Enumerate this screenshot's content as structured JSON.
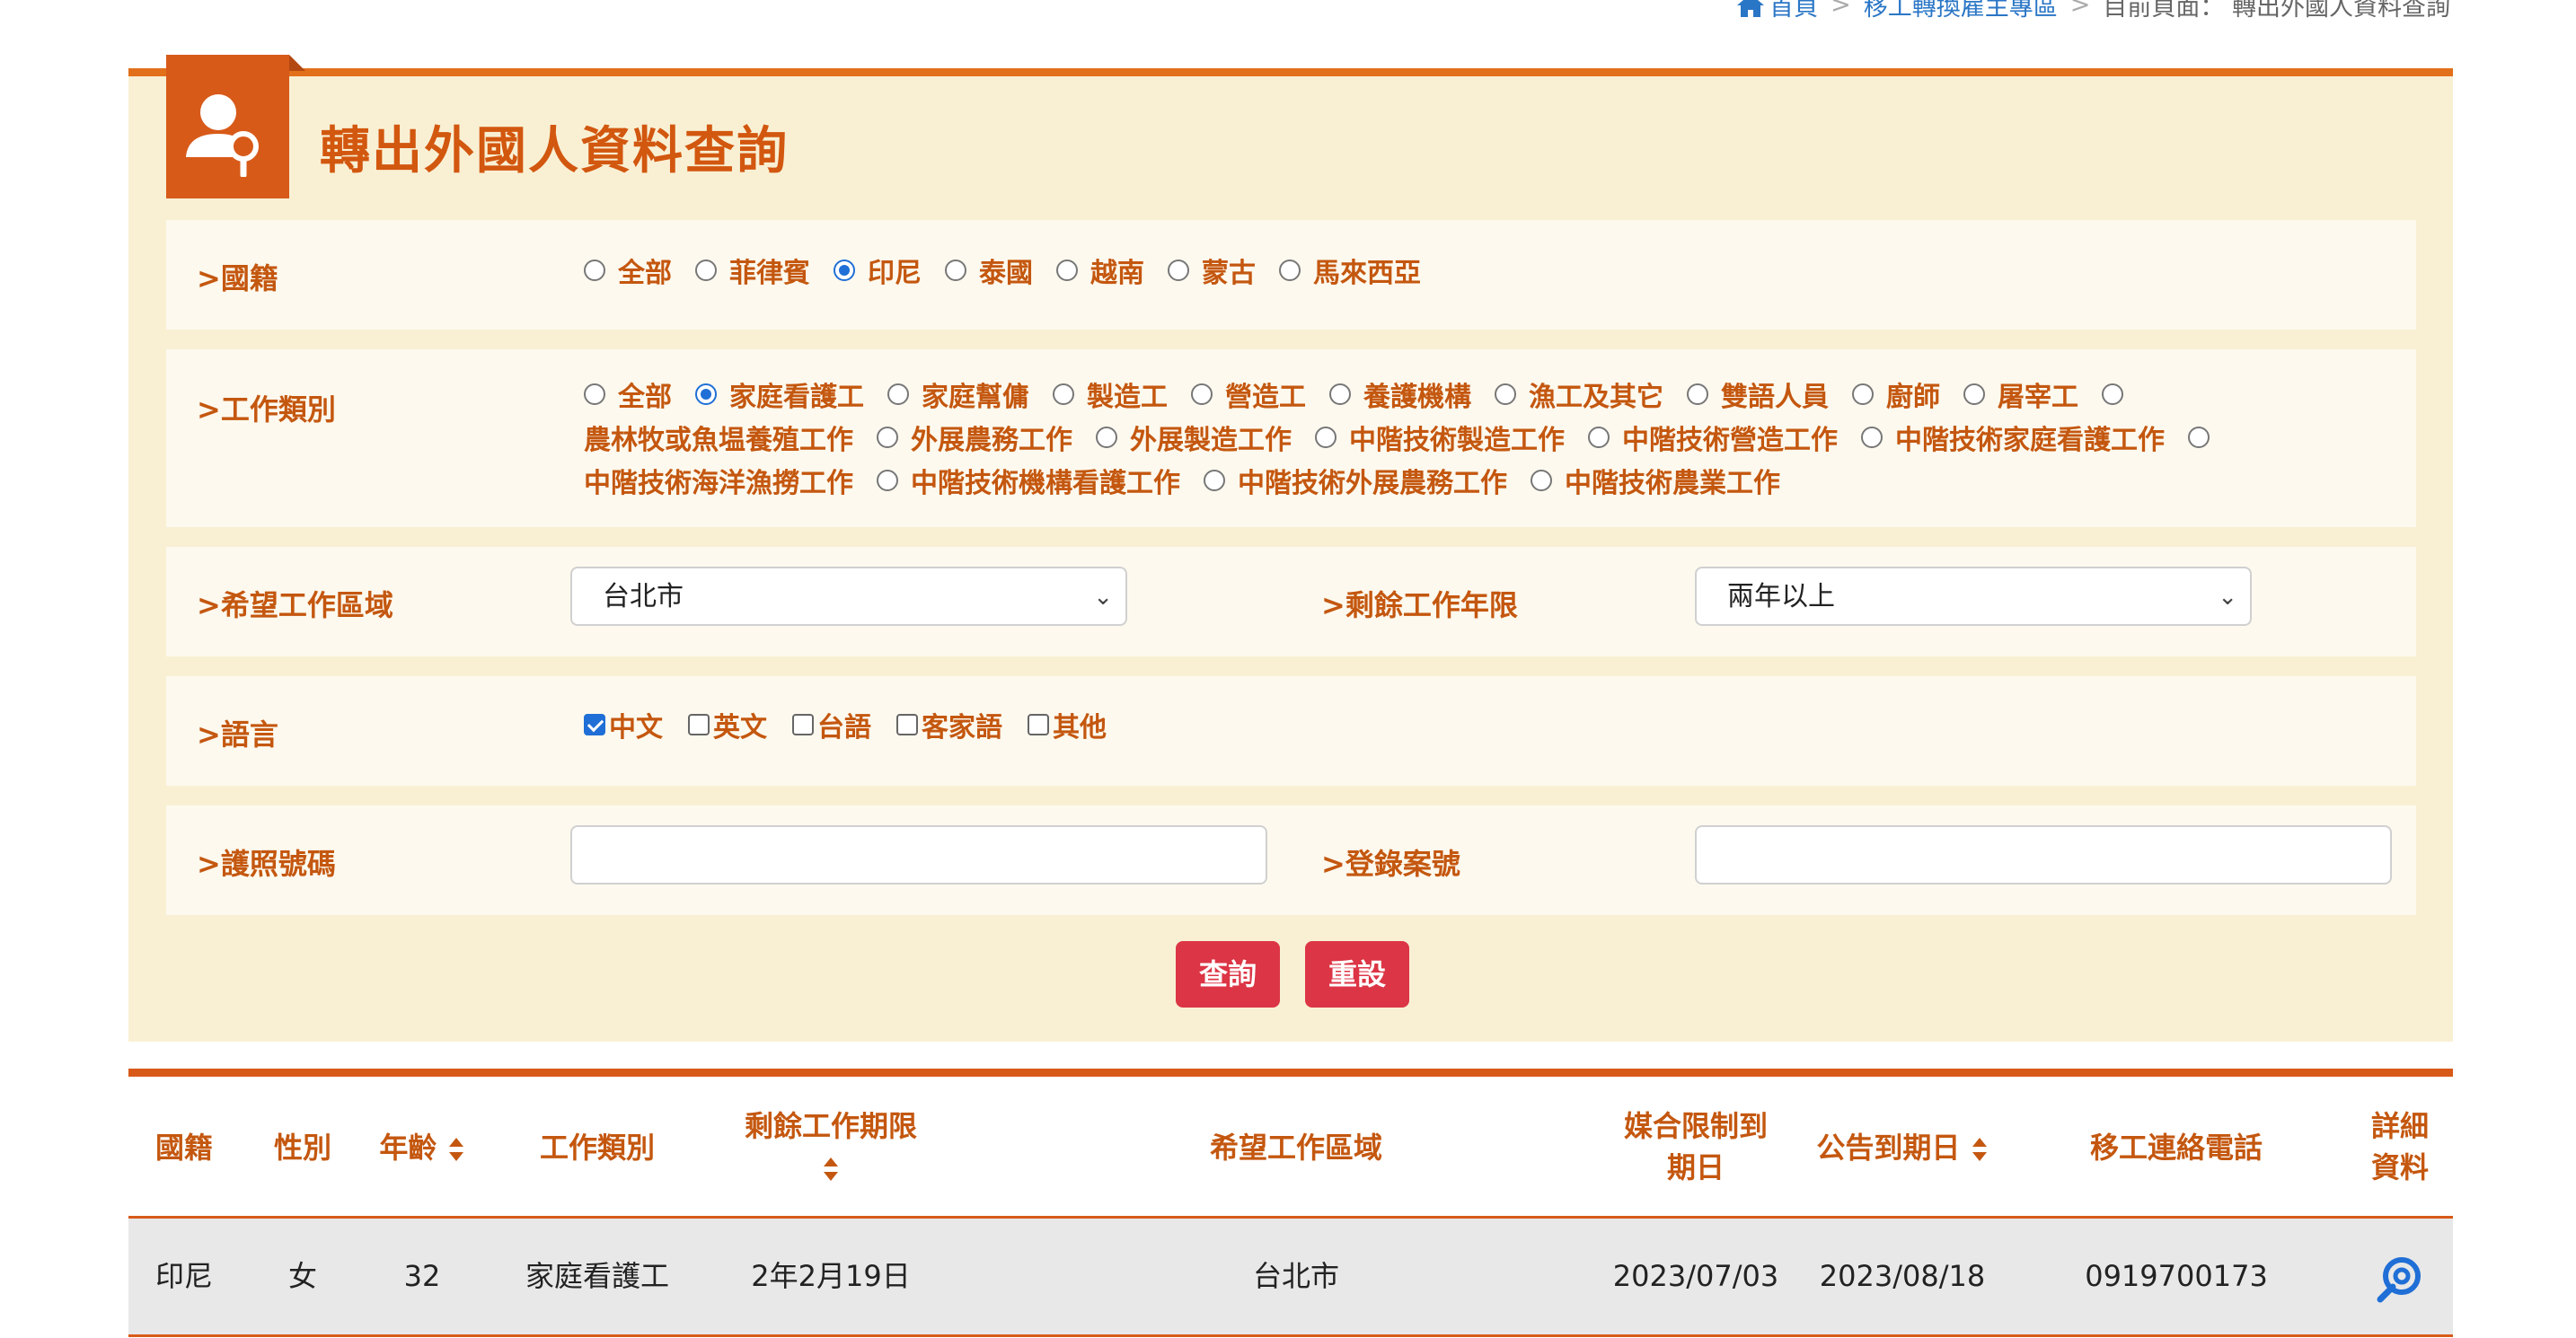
{
  "breadcrumb": {
    "home": "首頁",
    "section": "移工轉換雇主專區",
    "current": "目前頁面： 轉出外國人資料查詢"
  },
  "page": {
    "title": "轉出外國人資料查詢"
  },
  "nationality": {
    "label": "國籍",
    "options": [
      "全部",
      "菲律賓",
      "印尼",
      "泰國",
      "越南",
      "蒙古",
      "馬來西亞"
    ],
    "selected": "印尼"
  },
  "job_type": {
    "label": "工作類別",
    "options": [
      "全部",
      "家庭看護工",
      "家庭幫傭",
      "製造工",
      "營造工",
      "養護機構",
      "漁工及其它",
      "雙語人員",
      "廚師",
      "屠宰工",
      "農林牧或魚塭養殖工作",
      "外展農務工作",
      "外展製造工作",
      "中階技術製造工作",
      "中階技術營造工作",
      "中階技術家庭看護工作",
      "中階技術海洋漁撈工作",
      "中階技術機構看護工作",
      "中階技術外展農務工作",
      "中階技術農業工作"
    ],
    "selected": "家庭看護工"
  },
  "area": {
    "label": "希望工作區域",
    "value": "台北市"
  },
  "remaining": {
    "label": "剩餘工作年限",
    "value": "兩年以上"
  },
  "language": {
    "label": "語言",
    "options": [
      "中文",
      "英文",
      "台語",
      "客家語",
      "其他"
    ],
    "checked": [
      "中文"
    ]
  },
  "passport": {
    "label": "護照號碼",
    "value": ""
  },
  "case_no": {
    "label": "登錄案號",
    "value": ""
  },
  "buttons": {
    "search": "查詢",
    "reset": "重設"
  },
  "table": {
    "headers": {
      "nationality": "國籍",
      "gender": "性別",
      "age": "年齡",
      "job_type": "工作類別",
      "remaining_line1": "剩餘工作期限",
      "area": "希望工作區域",
      "match_line1": "媒合限制到",
      "match_line2": "期日",
      "announce": "公告到期日",
      "phone": "移工連絡電話",
      "detail_line1": "詳細",
      "detail_line2": "資料"
    },
    "rows": [
      {
        "nationality": "印尼",
        "gender": "女",
        "age": "32",
        "job_type": "家庭看護工",
        "remaining": "2年2月19日",
        "area": "台北市",
        "match_limit": "2023/07/03",
        "announce": "2023/08/18",
        "phone": "0919700173"
      }
    ]
  },
  "colors": {
    "accent": "#e2701b",
    "panel_bg": "#f9f0d4",
    "button": "#dc3545",
    "link": "#2a76c6"
  }
}
